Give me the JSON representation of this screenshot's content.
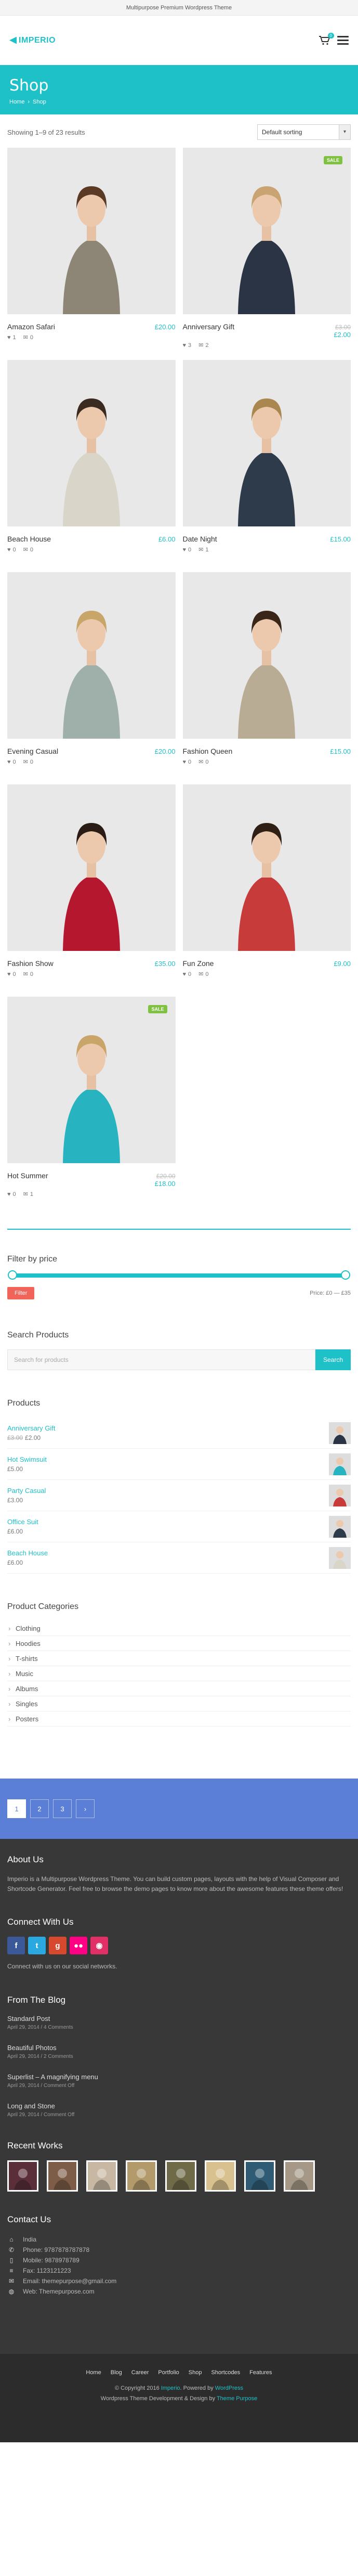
{
  "topbar": {
    "text": "Multipurpose Premium Wordpress Theme"
  },
  "header": {
    "logo": "IMPERIO",
    "cart_count": "0"
  },
  "hero": {
    "title": "Shop",
    "crumbs": [
      "Home",
      "Shop"
    ],
    "crumb_sep": "›"
  },
  "shop": {
    "results": "Showing 1–9 of 23 results",
    "sort": "Default sorting",
    "products": [
      {
        "name": "Amazon Safari",
        "price": "£20.00",
        "old_price": "",
        "sale": "",
        "likes": "1",
        "comments": "0",
        "dress": "#8d8677",
        "hair": "#5a3a24"
      },
      {
        "name": "Anniversary Gift",
        "price": "£2.00",
        "old_price": "£3.00",
        "sale": "SALE",
        "likes": "3",
        "comments": "2",
        "dress": "#2b3444",
        "hair": "#c9a472"
      },
      {
        "name": "Beach House",
        "price": "£6.00",
        "old_price": "",
        "sale": "",
        "likes": "0",
        "comments": "0",
        "dress": "#d9d5c8",
        "hair": "#3b2a1f"
      },
      {
        "name": "Date Night",
        "price": "£15.00",
        "old_price": "",
        "sale": "",
        "likes": "0",
        "comments": "1",
        "dress": "#2e3b4a",
        "hair": "#a9874f"
      },
      {
        "name": "Evening Casual",
        "price": "£20.00",
        "old_price": "",
        "sale": "",
        "likes": "0",
        "comments": "0",
        "dress": "#9fb0ab",
        "hair": "#c8a569"
      },
      {
        "name": "Fashion Queen",
        "price": "£15.00",
        "old_price": "",
        "sale": "",
        "likes": "0",
        "comments": "0",
        "dress": "#b9ac94",
        "hair": "#3a2618"
      },
      {
        "name": "Fashion Show",
        "price": "£35.00",
        "old_price": "",
        "sale": "",
        "likes": "0",
        "comments": "0",
        "dress": "#b5172f",
        "hair": "#2a1c14"
      },
      {
        "name": "Fun Zone",
        "price": "£9.00",
        "old_price": "",
        "sale": "",
        "likes": "0",
        "comments": "0",
        "dress": "#c83b3b",
        "hair": "#2f1f15"
      },
      {
        "name": "Hot Summer",
        "price": "£18.00",
        "old_price": "£20.00",
        "sale": "SALE",
        "likes": "0",
        "comments": "1",
        "dress": "#27b3c0",
        "hair": "#c9a569"
      }
    ]
  },
  "filter": {
    "title": "Filter by price",
    "button": "Filter",
    "range": "Price: £0 — £35"
  },
  "search": {
    "title": "Search Products",
    "placeholder": "Search for products",
    "button": "Search"
  },
  "product_widget": {
    "title": "Products",
    "items": [
      {
        "name": "Anniversary Gift",
        "old": "£3.00",
        "price": "£2.00",
        "color": "#2b3444"
      },
      {
        "name": "Hot Swimsuit",
        "old": "",
        "price": "£5.00",
        "color": "#27b3c0"
      },
      {
        "name": "Party Casual",
        "old": "",
        "price": "£3.00",
        "color": "#c83b3b"
      },
      {
        "name": "Office Suit",
        "old": "",
        "price": "£6.00",
        "color": "#2e3b4a"
      },
      {
        "name": "Beach House",
        "old": "",
        "price": "£6.00",
        "color": "#d9d5c8"
      }
    ]
  },
  "categories": {
    "title": "Product Categories",
    "items": [
      "Clothing",
      "Hoodies",
      "T-shirts",
      "Music",
      "Albums",
      "Singles",
      "Posters"
    ]
  },
  "pagination": [
    "1",
    "2",
    "3",
    "›"
  ],
  "footer": {
    "about_title": "About Us",
    "about_text": "Imperio is a Multipurpose Wordpress Theme. You can build custom pages, layouts with the help of Visual Composer and Shortcode Generator. Feel free to browse the demo pages to know more about the awesome features these theme offers!",
    "connect_title": "Connect With Us",
    "socials": [
      {
        "glyph": "f",
        "color": "#3b5998"
      },
      {
        "glyph": "t",
        "color": "#2aa9e0"
      },
      {
        "glyph": "g",
        "color": "#d6492f"
      },
      {
        "glyph": "●●",
        "color": "#ff0084"
      },
      {
        "glyph": "◉",
        "color": "#e12f67"
      }
    ],
    "connect_text": "Connect with us on our social networks.",
    "blog_title": "From The Blog",
    "blog": [
      {
        "title": "Standard Post",
        "meta": "April 29, 2014 / 4 Comments"
      },
      {
        "title": "Beautiful Photos",
        "meta": "April 29, 2014 / 2 Comments"
      },
      {
        "title": "Superlist – A magnifying menu",
        "meta": "April 29, 2014 / Comment Off"
      },
      {
        "title": "Long and Stone",
        "meta": "April 29, 2014 / Comment Off"
      }
    ],
    "works_title": "Recent Works",
    "works": [
      "#5a2f3a",
      "#7d5d47",
      "#c8b8a3",
      "#b29a6a",
      "#6f6a48",
      "#d8c08f",
      "#2f5b74",
      "#a69886"
    ],
    "contact_title": "Contact Us",
    "contact": [
      {
        "icon": "⌂",
        "text": "India"
      },
      {
        "icon": "✆",
        "text": "Phone: 9787878787878"
      },
      {
        "icon": "▯",
        "text": "Mobile: 9878978789"
      },
      {
        "icon": "≡",
        "text": "Fax: 1123121223"
      },
      {
        "icon": "✉",
        "text": "Email: themepurpose@gmail.com"
      },
      {
        "icon": "◍",
        "text": "Web: Themepurpose.com"
      }
    ],
    "bottom_nav": [
      "Home",
      "Blog",
      "Career",
      "Portfolio",
      "Shop",
      "Shortcodes",
      "Features"
    ],
    "copyright_prefix": "© Copyright 2016",
    "copyright_brand": "Imperio",
    "copyright_mid": ". Powered by",
    "copyright_wp": "WordPress",
    "credit_text": "Wordpress Theme Development & Design by",
    "credit_link": "Theme Purpose"
  }
}
